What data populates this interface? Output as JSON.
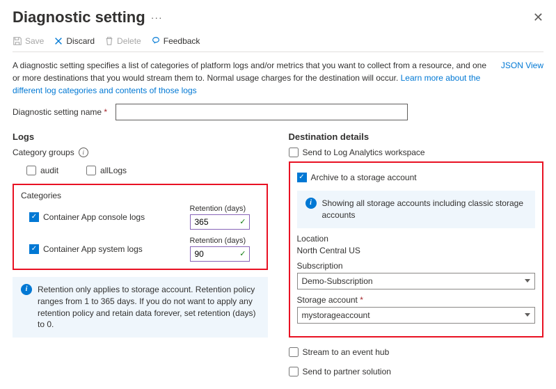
{
  "title": "Diagnostic setting",
  "toolbar": {
    "save": "Save",
    "discard": "Discard",
    "delete": "Delete",
    "feedback": "Feedback"
  },
  "desc": {
    "text": "A diagnostic setting specifies a list of categories of platform logs and/or metrics that you want to collect from a resource, and one or more destinations that you would stream them to. Normal usage charges for the destination will occur. ",
    "link": "Learn more about the different log categories and contents of those logs",
    "jsonview": "JSON View"
  },
  "nameField": {
    "label": "Diagnostic setting name",
    "value": ""
  },
  "logs": {
    "title": "Logs",
    "groupsLabel": "Category groups",
    "groups": {
      "audit": "audit",
      "allLogs": "allLogs"
    },
    "catsLabel": "Categories",
    "cats": [
      {
        "label": "Container App console logs",
        "retentionLabel": "Retention (days)",
        "retention": "365"
      },
      {
        "label": "Container App system logs",
        "retentionLabel": "Retention (days)",
        "retention": "90"
      }
    ],
    "note": "Retention only applies to storage account. Retention policy ranges from 1 to 365 days. If you do not want to apply any retention policy and retain data forever, set retention (days) to 0."
  },
  "dest": {
    "title": "Destination details",
    "logAnalytics": "Send to Log Analytics workspace",
    "archive": "Archive to a storage account",
    "archiveNote": "Showing all storage accounts including classic storage accounts",
    "locationLabel": "Location",
    "location": "North Central US",
    "subLabel": "Subscription",
    "subscription": "Demo-Subscription",
    "saLabel": "Storage account",
    "storageAccount": "mystorageaccount",
    "eventHub": "Stream to an event hub",
    "partner": "Send to partner solution"
  }
}
